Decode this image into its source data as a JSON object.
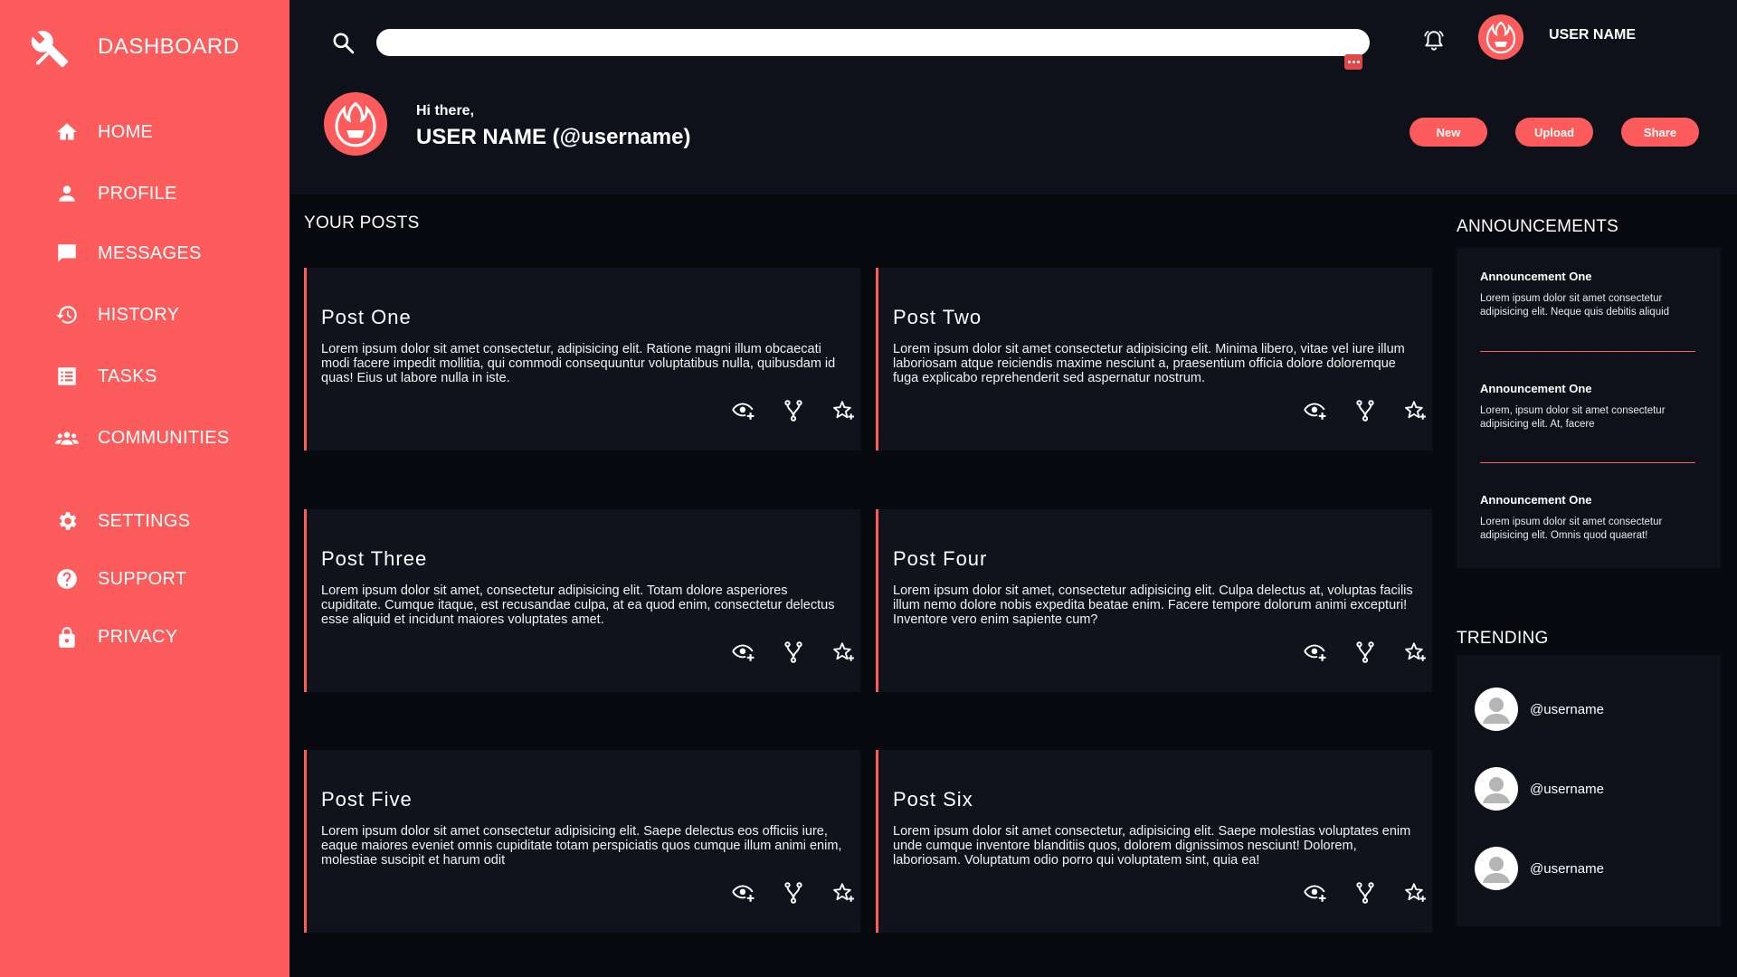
{
  "brand": {
    "title": "DASHBOARD"
  },
  "colors": {
    "accent": "#fd5c5c",
    "background": "#080a10",
    "panel": "#0f111a",
    "card": "#10131c"
  },
  "sidebar": {
    "items": [
      {
        "label": "HOME",
        "icon": "home-icon"
      },
      {
        "label": "PROFILE",
        "icon": "person-icon"
      },
      {
        "label": "MESSAGES",
        "icon": "chat-icon"
      },
      {
        "label": "HISTORY",
        "icon": "history-icon"
      },
      {
        "label": "TASKS",
        "icon": "list-icon"
      },
      {
        "label": "COMMUNITIES",
        "icon": "group-icon"
      },
      {
        "label": "SETTINGS",
        "icon": "gear-icon"
      },
      {
        "label": "SUPPORT",
        "icon": "help-icon"
      },
      {
        "label": "PRIVACY",
        "icon": "lock-icon"
      }
    ]
  },
  "header": {
    "search": {
      "value": "",
      "placeholder": ""
    },
    "username": "USER NAME",
    "greeting": "Hi there,",
    "full_name": "USER NAME (@username)",
    "buttons": {
      "new": "New",
      "upload": "Upload",
      "share": "Share"
    }
  },
  "posts": {
    "title": "YOUR POSTS",
    "items": [
      {
        "title": "Post One",
        "body": "Lorem ipsum dolor sit amet consectetur, adipisicing elit. Ratione magni illum obcaecati modi facere impedit mollitia, qui commodi consequuntur voluptatibus nulla, quibusdam id quas! Eius ut labore nulla in iste."
      },
      {
        "title": "Post Two",
        "body": "Lorem ipsum dolor sit amet consectetur adipisicing elit. Minima libero, vitae vel iure illum laboriosam atque reiciendis maxime nesciunt a, praesentium officia dolore doloremque fuga explicabo reprehenderit sed aspernatur nostrum."
      },
      {
        "title": "Post Three",
        "body": "Lorem ipsum dolor sit amet, consectetur adipisicing elit. Totam dolore asperiores cupiditate. Cumque itaque, est recusandae culpa, at ea quod enim, consectetur delectus esse aliquid et incidunt maiores voluptates amet."
      },
      {
        "title": "Post Four",
        "body": "Lorem ipsum dolor sit amet, consectetur adipisicing elit. Culpa delectus at, voluptas facilis illum nemo dolore nobis expedita beatae enim. Facere tempore dolorum animi excepturi! Inventore vero enim sapiente cum?"
      },
      {
        "title": "Post Five",
        "body": "Lorem ipsum dolor sit amet consectetur adipisicing elit. Saepe delectus eos officiis iure, eaque maiores eveniet omnis cupiditate totam perspiciatis quos cumque illum animi enim, molestiae suscipit et harum odit"
      },
      {
        "title": "Post Six",
        "body": "Lorem ipsum dolor sit amet consectetur, adipisicing elit. Saepe molestias voluptates enim unde cumque inventore blanditiis quos, dolorem dignissimos nesciunt! Dolorem, laboriosam. Voluptatum odio porro qui voluptatem sint, quia ea!"
      }
    ]
  },
  "announcements": {
    "title": "ANNOUNCEMENTS",
    "items": [
      {
        "title": "Announcement One",
        "text": "Lorem ipsum dolor sit amet consectetur adipisicing elit. Neque quis debitis aliquid"
      },
      {
        "title": "Announcement One",
        "text": "Lorem, ipsum dolor sit amet consectetur adipisicing elit. At, facere"
      },
      {
        "title": "Announcement One",
        "text": "Lorem ipsum dolor sit amet consectetur adipisicing elit. Omnis quod quaerat!"
      }
    ]
  },
  "trending": {
    "title": "TRENDING",
    "items": [
      {
        "name": "@username"
      },
      {
        "name": "@username"
      },
      {
        "name": "@username"
      }
    ]
  }
}
